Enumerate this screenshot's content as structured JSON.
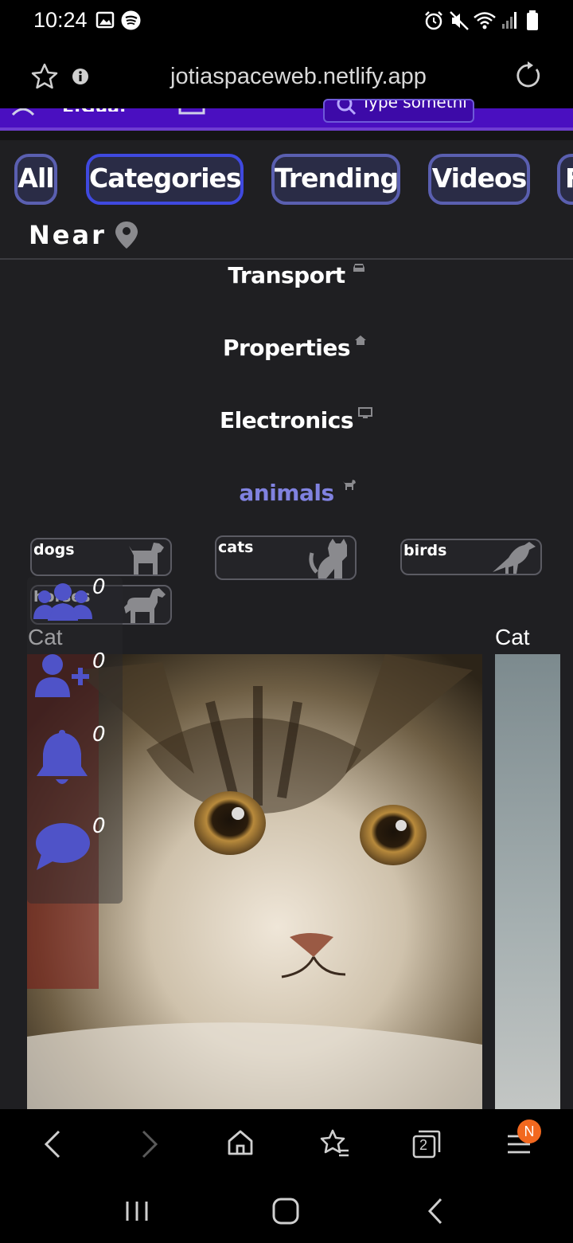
{
  "status_bar": {
    "time": "10:24",
    "icons": [
      "image-icon",
      "spotify-icon",
      "alarm-icon",
      "mute-icon",
      "wifi-icon",
      "signal-icon",
      "battery-icon"
    ]
  },
  "browser": {
    "url": "jotiaspaceweb.netlify.app",
    "icons": [
      "bookmark-star-icon",
      "info-icon",
      "reload-icon"
    ]
  },
  "site_header": {
    "search_placeholder": "Type somethi"
  },
  "tabs": [
    {
      "label": "All"
    },
    {
      "label": "Categories",
      "active": true
    },
    {
      "label": "Trending"
    },
    {
      "label": "Videos"
    },
    {
      "label": "F"
    }
  ],
  "near": {
    "label": "Near",
    "icon": "location-pin-icon"
  },
  "categories": [
    {
      "label": "Transport",
      "icon": "car-icon"
    },
    {
      "label": "Properties",
      "icon": "home-icon"
    },
    {
      "label": "Electronics",
      "icon": "monitor-icon"
    },
    {
      "label": "animals",
      "icon": "dog-icon",
      "selected": true
    }
  ],
  "subcategories": [
    {
      "label": "dogs",
      "icon": "dog-icon"
    },
    {
      "label": "cats",
      "icon": "cat-icon"
    },
    {
      "label": "birds",
      "icon": "crow-icon"
    },
    {
      "label": "horses",
      "icon": "horse-icon"
    }
  ],
  "posts": [
    {
      "title": "Cat"
    },
    {
      "title": "Cat"
    }
  ],
  "side_actions": [
    {
      "icon": "users-icon",
      "count": "0"
    },
    {
      "icon": "user-plus-icon",
      "count": "0"
    },
    {
      "icon": "bell-icon",
      "count": "0"
    },
    {
      "icon": "chat-icon",
      "count": "0"
    }
  ],
  "browser_nav": {
    "tabs_count": "2",
    "badge": "N"
  },
  "colors": {
    "accent": "#5a5fb0",
    "active_tab": "#3f49e0",
    "selected_category": "#8082e0",
    "site_header": "#4a0fc0",
    "icon_blue": "#4f53c8",
    "badge": "#f2681f"
  }
}
